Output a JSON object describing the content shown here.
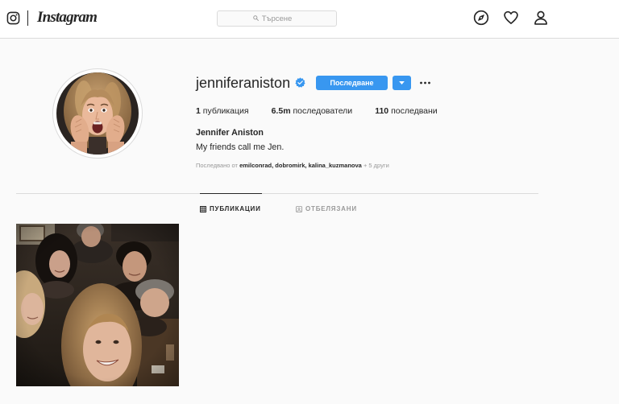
{
  "nav": {
    "logo_wordmark": "Instagram",
    "search_placeholder": "Търсене",
    "icons": {
      "logo": "instagram-camera-icon",
      "search": "search-icon",
      "explore": "compass-icon",
      "activity": "heart-icon",
      "profile": "person-icon"
    }
  },
  "profile": {
    "username": "jenniferaniston",
    "verified": true,
    "follow_label": "Последване",
    "stats": [
      {
        "count": "1",
        "label": "публикация"
      },
      {
        "count": "6.5m",
        "label": "последователи"
      },
      {
        "count": "110",
        "label": "последвани"
      }
    ],
    "full_name": "Jennifer Aniston",
    "bio": "My friends call me Jen.",
    "followed_by": {
      "prefix": "Последвано от",
      "names": [
        "emilconrad",
        "dobromirk",
        "kalina_kuzmanova"
      ],
      "separator": ",",
      "suffix": "+ 5 други"
    },
    "icons": {
      "verified": "verified-badge-icon",
      "dropdown": "chevron-down-icon",
      "more": "more-options-icon"
    }
  },
  "tabs": [
    {
      "label": "ПУБЛИКАЦИИ",
      "icon": "grid-icon",
      "active": true
    },
    {
      "label": "ОТБЕЛЯЗАНИ",
      "icon": "tagged-icon",
      "active": false
    }
  ],
  "colors": {
    "accent": "#3897f0",
    "text": "#262626",
    "muted": "#999999",
    "border": "#dbdbdb",
    "page_background": "#fafafa"
  }
}
